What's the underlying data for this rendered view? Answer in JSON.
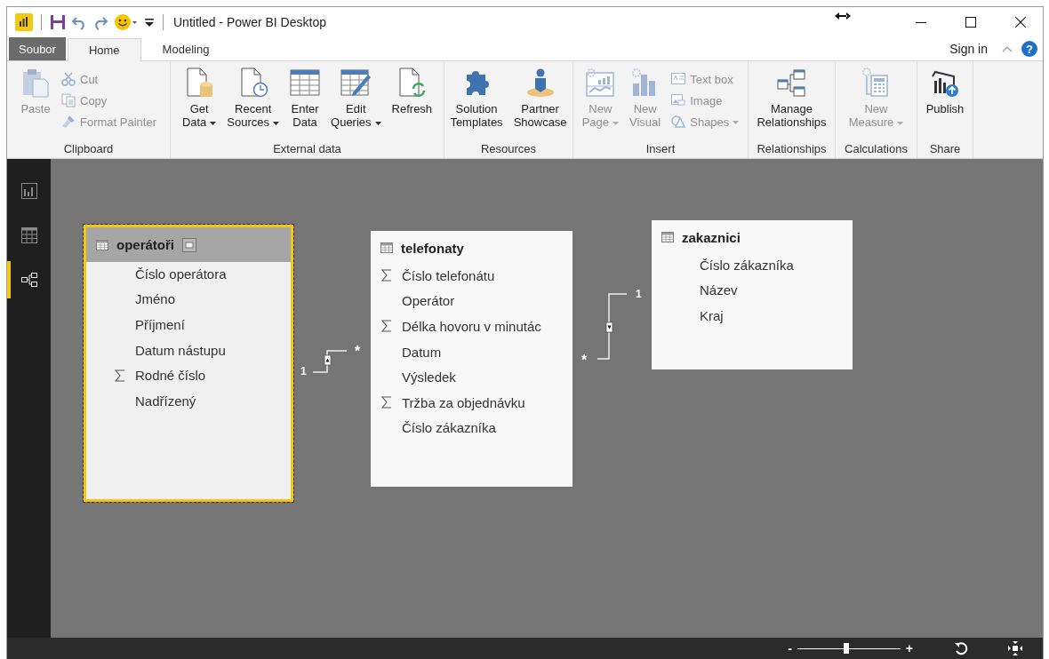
{
  "window": {
    "title": "Untitled - Power BI Desktop"
  },
  "tabs": [
    {
      "label": "Soubor",
      "kind": "file",
      "selected": false
    },
    {
      "label": "Home",
      "kind": "tab",
      "selected": true
    },
    {
      "label": "Modeling",
      "kind": "tab",
      "selected": false
    }
  ],
  "sign_in": "Sign in",
  "help": "?",
  "ribbon": [
    {
      "label": "Clipboard",
      "buttons": [
        {
          "kind": "large",
          "label": "Paste",
          "disabled": true,
          "dropdown": false
        },
        {
          "kind": "small",
          "label": "Cut",
          "disabled": true,
          "dropdown": false
        },
        {
          "kind": "small",
          "label": "Copy",
          "disabled": true,
          "dropdown": false
        },
        {
          "kind": "small",
          "label": "Format Painter",
          "disabled": true,
          "dropdown": false
        }
      ]
    },
    {
      "label": "External data",
      "buttons": [
        {
          "kind": "large",
          "label": "Get\nData",
          "disabled": false,
          "dropdown": true
        },
        {
          "kind": "large",
          "label": "Recent\nSources",
          "disabled": false,
          "dropdown": true
        },
        {
          "kind": "large",
          "label": "Enter\nData",
          "disabled": false,
          "dropdown": false
        },
        {
          "kind": "large",
          "label": "Edit\nQueries",
          "disabled": false,
          "dropdown": true
        },
        {
          "kind": "large",
          "label": "Refresh",
          "disabled": false,
          "dropdown": false
        }
      ]
    },
    {
      "label": "Resources",
      "buttons": [
        {
          "kind": "large",
          "label": "Solution\nTemplates",
          "disabled": false,
          "dropdown": false
        },
        {
          "kind": "large",
          "label": "Partner\nShowcase",
          "disabled": false,
          "dropdown": false
        }
      ]
    },
    {
      "label": "Insert",
      "buttons": [
        {
          "kind": "large",
          "label": "New\nPage",
          "disabled": true,
          "dropdown": true
        },
        {
          "kind": "large",
          "label": "New\nVisual",
          "disabled": true,
          "dropdown": false
        },
        {
          "kind": "small",
          "label": "Text box",
          "disabled": true,
          "dropdown": false
        },
        {
          "kind": "small",
          "label": "Image",
          "disabled": true,
          "dropdown": false
        },
        {
          "kind": "small",
          "label": "Shapes",
          "disabled": true,
          "dropdown": true
        }
      ]
    },
    {
      "label": "Relationships",
      "buttons": [
        {
          "kind": "large",
          "label": "Manage\nRelationships",
          "disabled": false,
          "dropdown": false
        }
      ]
    },
    {
      "label": "Calculations",
      "buttons": [
        {
          "kind": "large",
          "label": "New\nMeasure",
          "disabled": true,
          "dropdown": true
        }
      ]
    },
    {
      "label": "Share",
      "buttons": [
        {
          "kind": "large",
          "label": "Publish",
          "disabled": false,
          "dropdown": false
        }
      ]
    }
  ],
  "nav": [
    {
      "kind": "report",
      "selected": false
    },
    {
      "kind": "data",
      "selected": false
    },
    {
      "kind": "model",
      "selected": true
    }
  ],
  "tables": [
    {
      "name": "operátoři",
      "selected": true,
      "fields": [
        {
          "name": "Číslo operátora",
          "aggregate": false
        },
        {
          "name": "Jméno",
          "aggregate": false
        },
        {
          "name": "Příjmení",
          "aggregate": false
        },
        {
          "name": "Datum nástupu",
          "aggregate": false
        },
        {
          "name": "Rodné číslo",
          "aggregate": true
        },
        {
          "name": "Nadřízený",
          "aggregate": false
        }
      ]
    },
    {
      "name": "telefonaty",
      "selected": false,
      "fields": [
        {
          "name": "Číslo telefonátu",
          "aggregate": true
        },
        {
          "name": "Operátor",
          "aggregate": false
        },
        {
          "name": "Délka hovoru v minutác",
          "aggregate": true
        },
        {
          "name": "Datum",
          "aggregate": false
        },
        {
          "name": "Výsledek",
          "aggregate": false
        },
        {
          "name": "Tržba za objednávku",
          "aggregate": true
        },
        {
          "name": "Číslo zákazníka",
          "aggregate": false
        }
      ]
    },
    {
      "name": "zakaznici",
      "selected": false,
      "fields": [
        {
          "name": "Číslo zákazníka",
          "aggregate": false
        },
        {
          "name": "Název",
          "aggregate": false
        },
        {
          "name": "Kraj",
          "aggregate": false
        }
      ]
    }
  ],
  "relationships": [
    {
      "one_label": "1",
      "many_label": "*",
      "arrow_up": true
    },
    {
      "one_label": "1",
      "many_label": "*",
      "arrow_up": false
    }
  ],
  "zoom": {
    "minus": "-",
    "plus": "+",
    "level": 0.48
  }
}
